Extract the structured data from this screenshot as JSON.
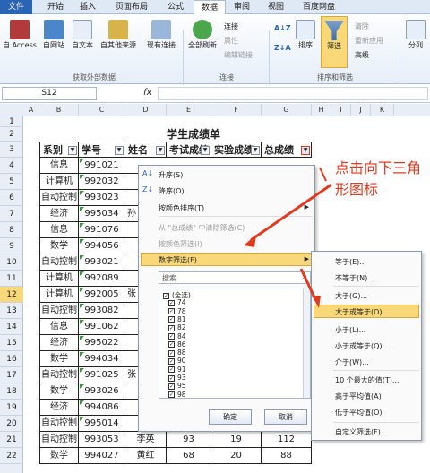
{
  "tabs": [
    "文件",
    "开始",
    "插入",
    "页面布局",
    "公式",
    "数据",
    "审阅",
    "视图",
    "百度网盘"
  ],
  "ribbon": {
    "external": [
      "自 Access",
      "自网站",
      "自文本",
      "自其他来源"
    ],
    "existing": "现有连接",
    "refresh": "全部刷新",
    "conn_small": [
      "连接",
      "属性",
      "编辑链接"
    ],
    "sort_small": [
      "A↓Z",
      "Z↓A"
    ],
    "sort": "排序",
    "filter": "筛选",
    "filter_small": [
      "清除",
      "重新应用",
      "高级"
    ],
    "split": "分列",
    "groups": [
      "获取外部数据",
      "连接",
      "排序和筛选"
    ]
  },
  "namebox": "S12",
  "fx": "fx",
  "columns": [
    "A",
    "B",
    "C",
    "D",
    "E",
    "F",
    "G",
    "H",
    "I",
    "J",
    "K"
  ],
  "rows": [
    "1",
    "2",
    "3",
    "4",
    "5",
    "6",
    "7",
    "8",
    "9",
    "10",
    "11",
    "12",
    "13",
    "14",
    "15",
    "16",
    "17",
    "18",
    "19",
    "20",
    "21",
    "22"
  ],
  "sheet": {
    "title": "学生成绩单",
    "headers": [
      "系别",
      "学号",
      "姓名",
      "考试成绩",
      "实验成绩",
      "总成绩"
    ],
    "dept": [
      "信息",
      "计算机",
      "自动控制",
      "经济",
      "信息",
      "数学",
      "自动控制",
      "计算机",
      "计算机",
      "自动控制",
      "信息",
      "经济",
      "数学",
      "自动控制",
      "数学",
      "经济",
      "自动控制",
      "数学"
    ],
    "id": [
      "991021",
      "992032",
      "993023",
      "995034",
      "991076",
      "994056",
      "993021",
      "992089",
      "992005",
      "993082",
      "991062",
      "995022",
      "994034",
      "991025",
      "993026",
      "994086",
      "995014",
      "993053",
      "994027"
    ],
    "name_partial": [
      "",
      "",
      "",
      "孙",
      "",
      "",
      "",
      "",
      "张",
      "",
      "",
      "",
      "",
      "张",
      "",
      "",
      "",
      ""
    ],
    "row21": [
      "自动控制",
      "993053",
      "李英",
      "93",
      "19",
      "112"
    ],
    "row22": [
      "数学",
      "994027",
      "黄红",
      "68",
      "20",
      "88"
    ]
  },
  "menu": {
    "items": [
      "升序(S)",
      "降序(O)",
      "按颜色排序(T)",
      "从 \"总成绩\" 中清除筛选(C)",
      "按颜色筛选(I)",
      "数字筛选(F)"
    ],
    "search": "搜索",
    "checks": [
      "(全选)",
      "74",
      "78",
      "81",
      "82",
      "84",
      "86",
      "88",
      "90",
      "91",
      "93",
      "95",
      "98"
    ],
    "ok": "确定",
    "cancel": "取消"
  },
  "submenu": [
    "等于(E)...",
    "不等于(N)...",
    "大于(G)...",
    "大于或等于(O)...",
    "小于(L)...",
    "小于或等于(Q)...",
    "介于(W)...",
    "10 个最大的值(T)...",
    "高于平均值(A)",
    "低于平均值(O)",
    "自定义筛选(F)..."
  ],
  "annotation": "点击向下三角形图标",
  "colors": {
    "accent": "#2a64b5",
    "highlight": "#f8d878",
    "arrow": "#e23a1e"
  }
}
